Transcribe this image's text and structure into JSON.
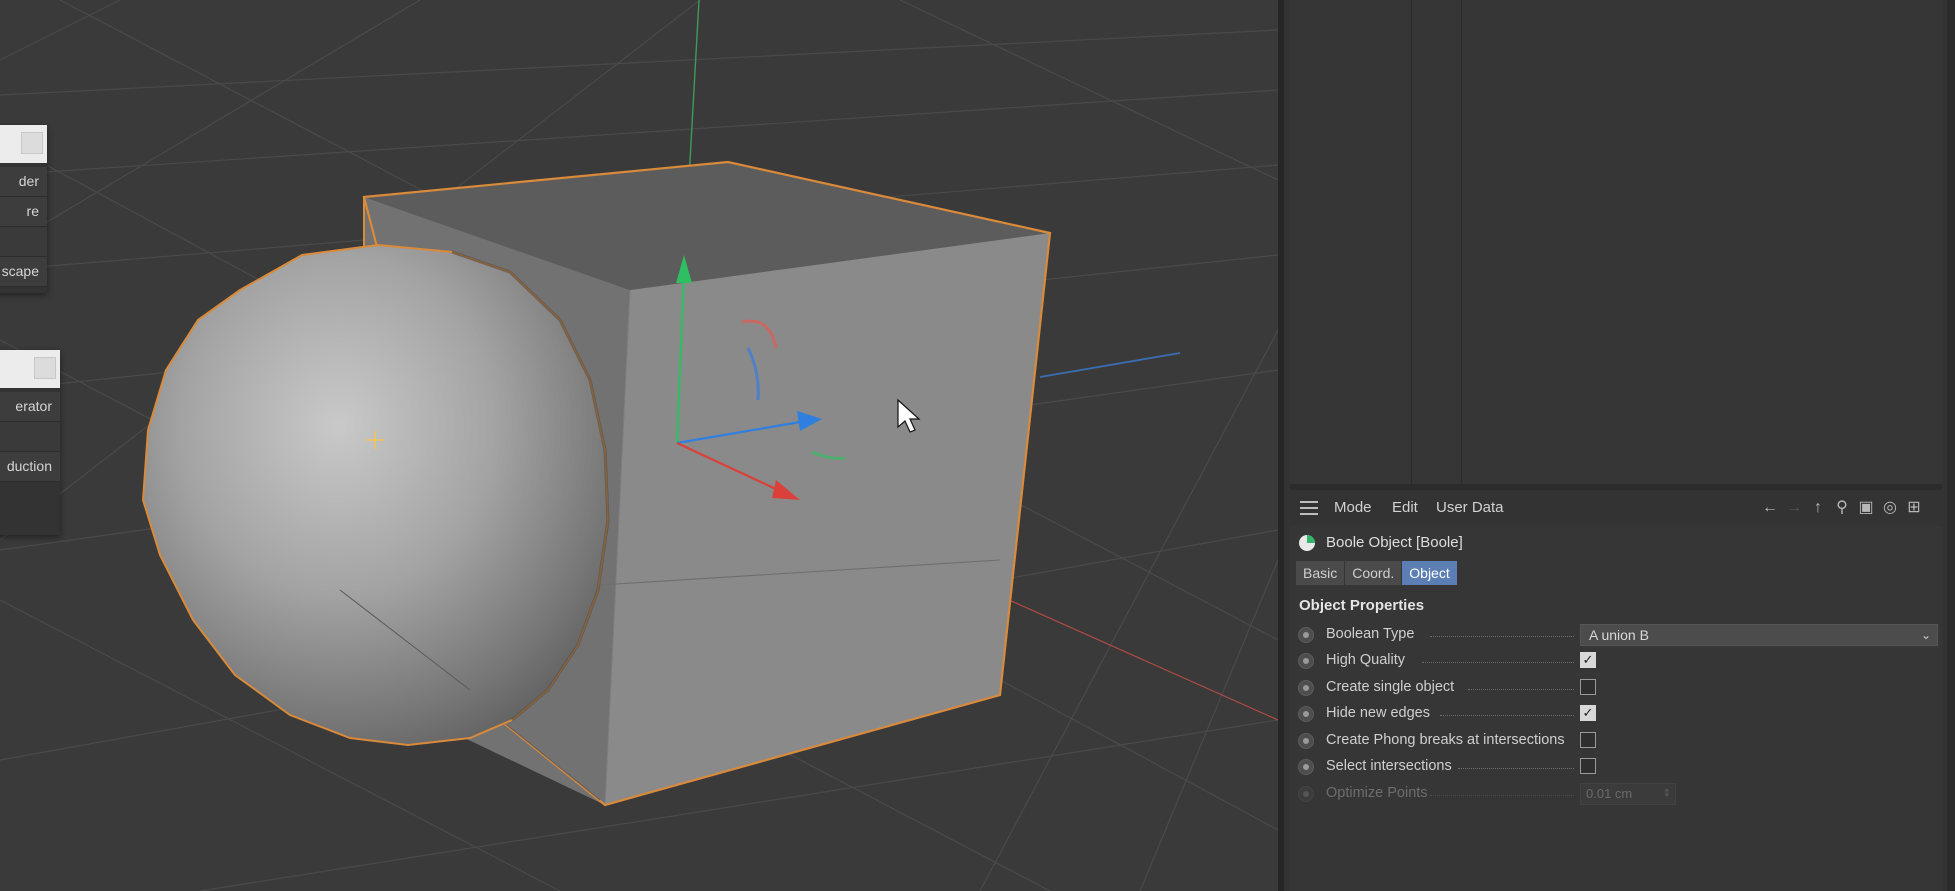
{
  "viewport": {
    "popup1": {
      "items": [
        "der",
        "re",
        "",
        "scape"
      ]
    },
    "popup2": {
      "items": [
        "erator",
        "",
        "duction"
      ]
    },
    "colors": {
      "background": "#3a3a3a",
      "selection_outline": "#d98a3a",
      "axis_x": "#d9413a",
      "axis_y": "#2fbf62",
      "axis_z": "#2f7fe0"
    },
    "cursor_icon": "arrow-cursor-icon",
    "null_marker_icon": "plus-icon"
  },
  "attributes": {
    "menu": {
      "mode": "Mode",
      "edit": "Edit",
      "user_data": "User Data"
    },
    "toolbar_icons": [
      "back-arrow-icon",
      "forward-arrow-icon",
      "up-arrow-icon",
      "search-icon",
      "lock-icon",
      "target-icon",
      "add-panel-icon"
    ],
    "object_title": "Boole Object [Boole]",
    "tabs": {
      "basic": "Basic",
      "coord": "Coord.",
      "object": "Object"
    },
    "active_tab": "Object",
    "section_title": "Object Properties",
    "props": {
      "boolean_type": {
        "label": "Boolean Type",
        "value": "A union B"
      },
      "high_quality": {
        "label": "High Quality",
        "checked": true
      },
      "create_single_object": {
        "label": "Create single object",
        "checked": false
      },
      "hide_new_edges": {
        "label": "Hide new edges",
        "checked": true
      },
      "phong_breaks": {
        "label": "Create Phong breaks at intersections",
        "checked": false
      },
      "select_intersections": {
        "label": "Select intersections",
        "checked": false
      },
      "optimize_points": {
        "label": "Optimize Points",
        "value": "0.01 cm",
        "enabled": false
      }
    }
  }
}
